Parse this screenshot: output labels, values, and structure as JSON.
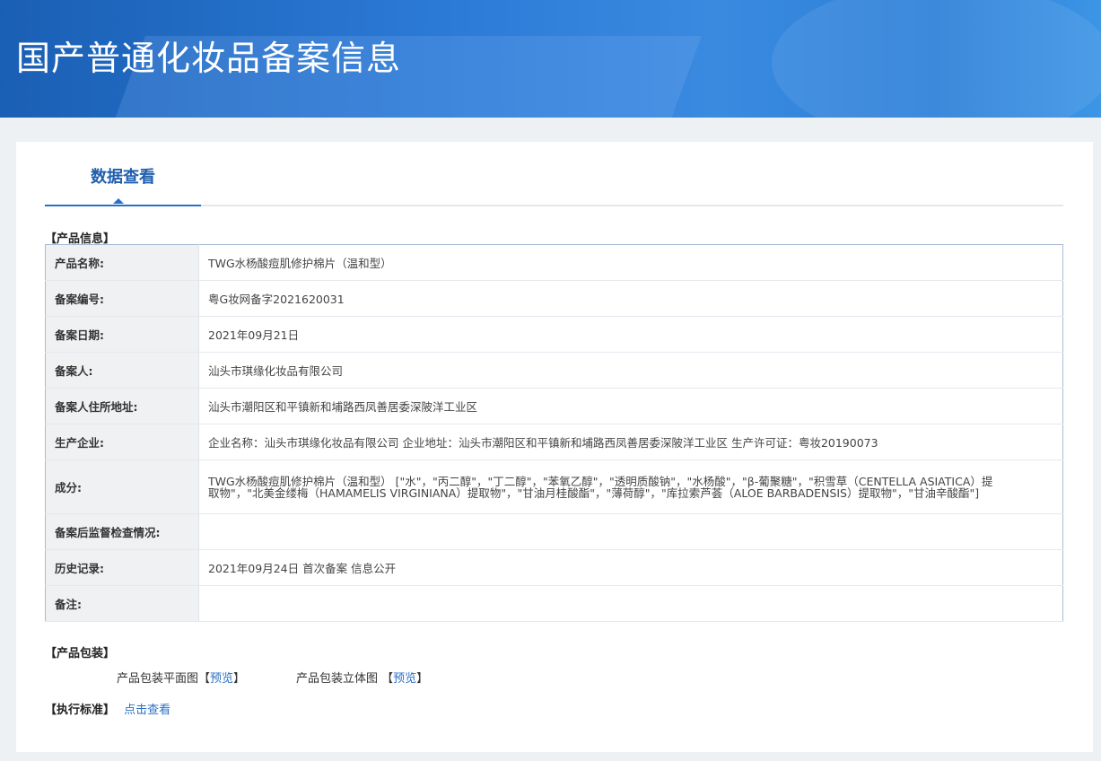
{
  "header": {
    "title": "国产普通化妆品备案信息"
  },
  "tabs": [
    {
      "label": "数据查看",
      "active": true
    }
  ],
  "product_info": {
    "heading": "【产品信息】",
    "rows": [
      {
        "label": "产品名称:",
        "value": "TWG水杨酸痘肌修护棉片（温和型）"
      },
      {
        "label": "备案编号:",
        "value": "粤G妆网备字2021620031"
      },
      {
        "label": "备案日期:",
        "value": "2021年09月21日"
      },
      {
        "label": "备案人:",
        "value": "汕头市琪缘化妆品有限公司"
      },
      {
        "label": "备案人住所地址:",
        "value": "汕头市潮阳区和平镇新和埔路西凤善居委深陂洋工业区"
      },
      {
        "label": "生产企业:",
        "value": "企业名称：汕头市琪缘化妆品有限公司 企业地址：汕头市潮阳区和平镇新和埔路西凤善居委深陂洋工业区 生产许可证：粤妆20190073"
      },
      {
        "label": "成分:",
        "value": "TWG水杨酸痘肌修护棉片（温和型） [\"水\"，\"丙二醇\"，\"丁二醇\"，\"苯氧乙醇\"，\"透明质酸钠\"，\"水杨酸\"，\"β-葡聚糖\"，\"积雪草（CENTELLA ASIATICA）提取物\"，\"北美金缕梅（HAMAMELIS VIRGINIANA）提取物\"，\"甘油月桂酸酯\"，\"薄荷醇\"，\"库拉索芦荟（ALOE BARBADENSIS）提取物\"，\"甘油辛酸酯\"]"
      },
      {
        "label": "备案后监督检查情况:",
        "value": ""
      },
      {
        "label": "历史记录:",
        "value": "2021年09月24日 首次备案 信息公开"
      },
      {
        "label": "备注:",
        "value": ""
      }
    ]
  },
  "packaging": {
    "heading": "【产品包装】",
    "flat_label": "产品包装平面图",
    "flat_link": "预览",
    "stereo_label": "产品包装立体图",
    "stereo_link": "预览"
  },
  "standard": {
    "heading": "【执行标准】",
    "link": "点击查看"
  }
}
